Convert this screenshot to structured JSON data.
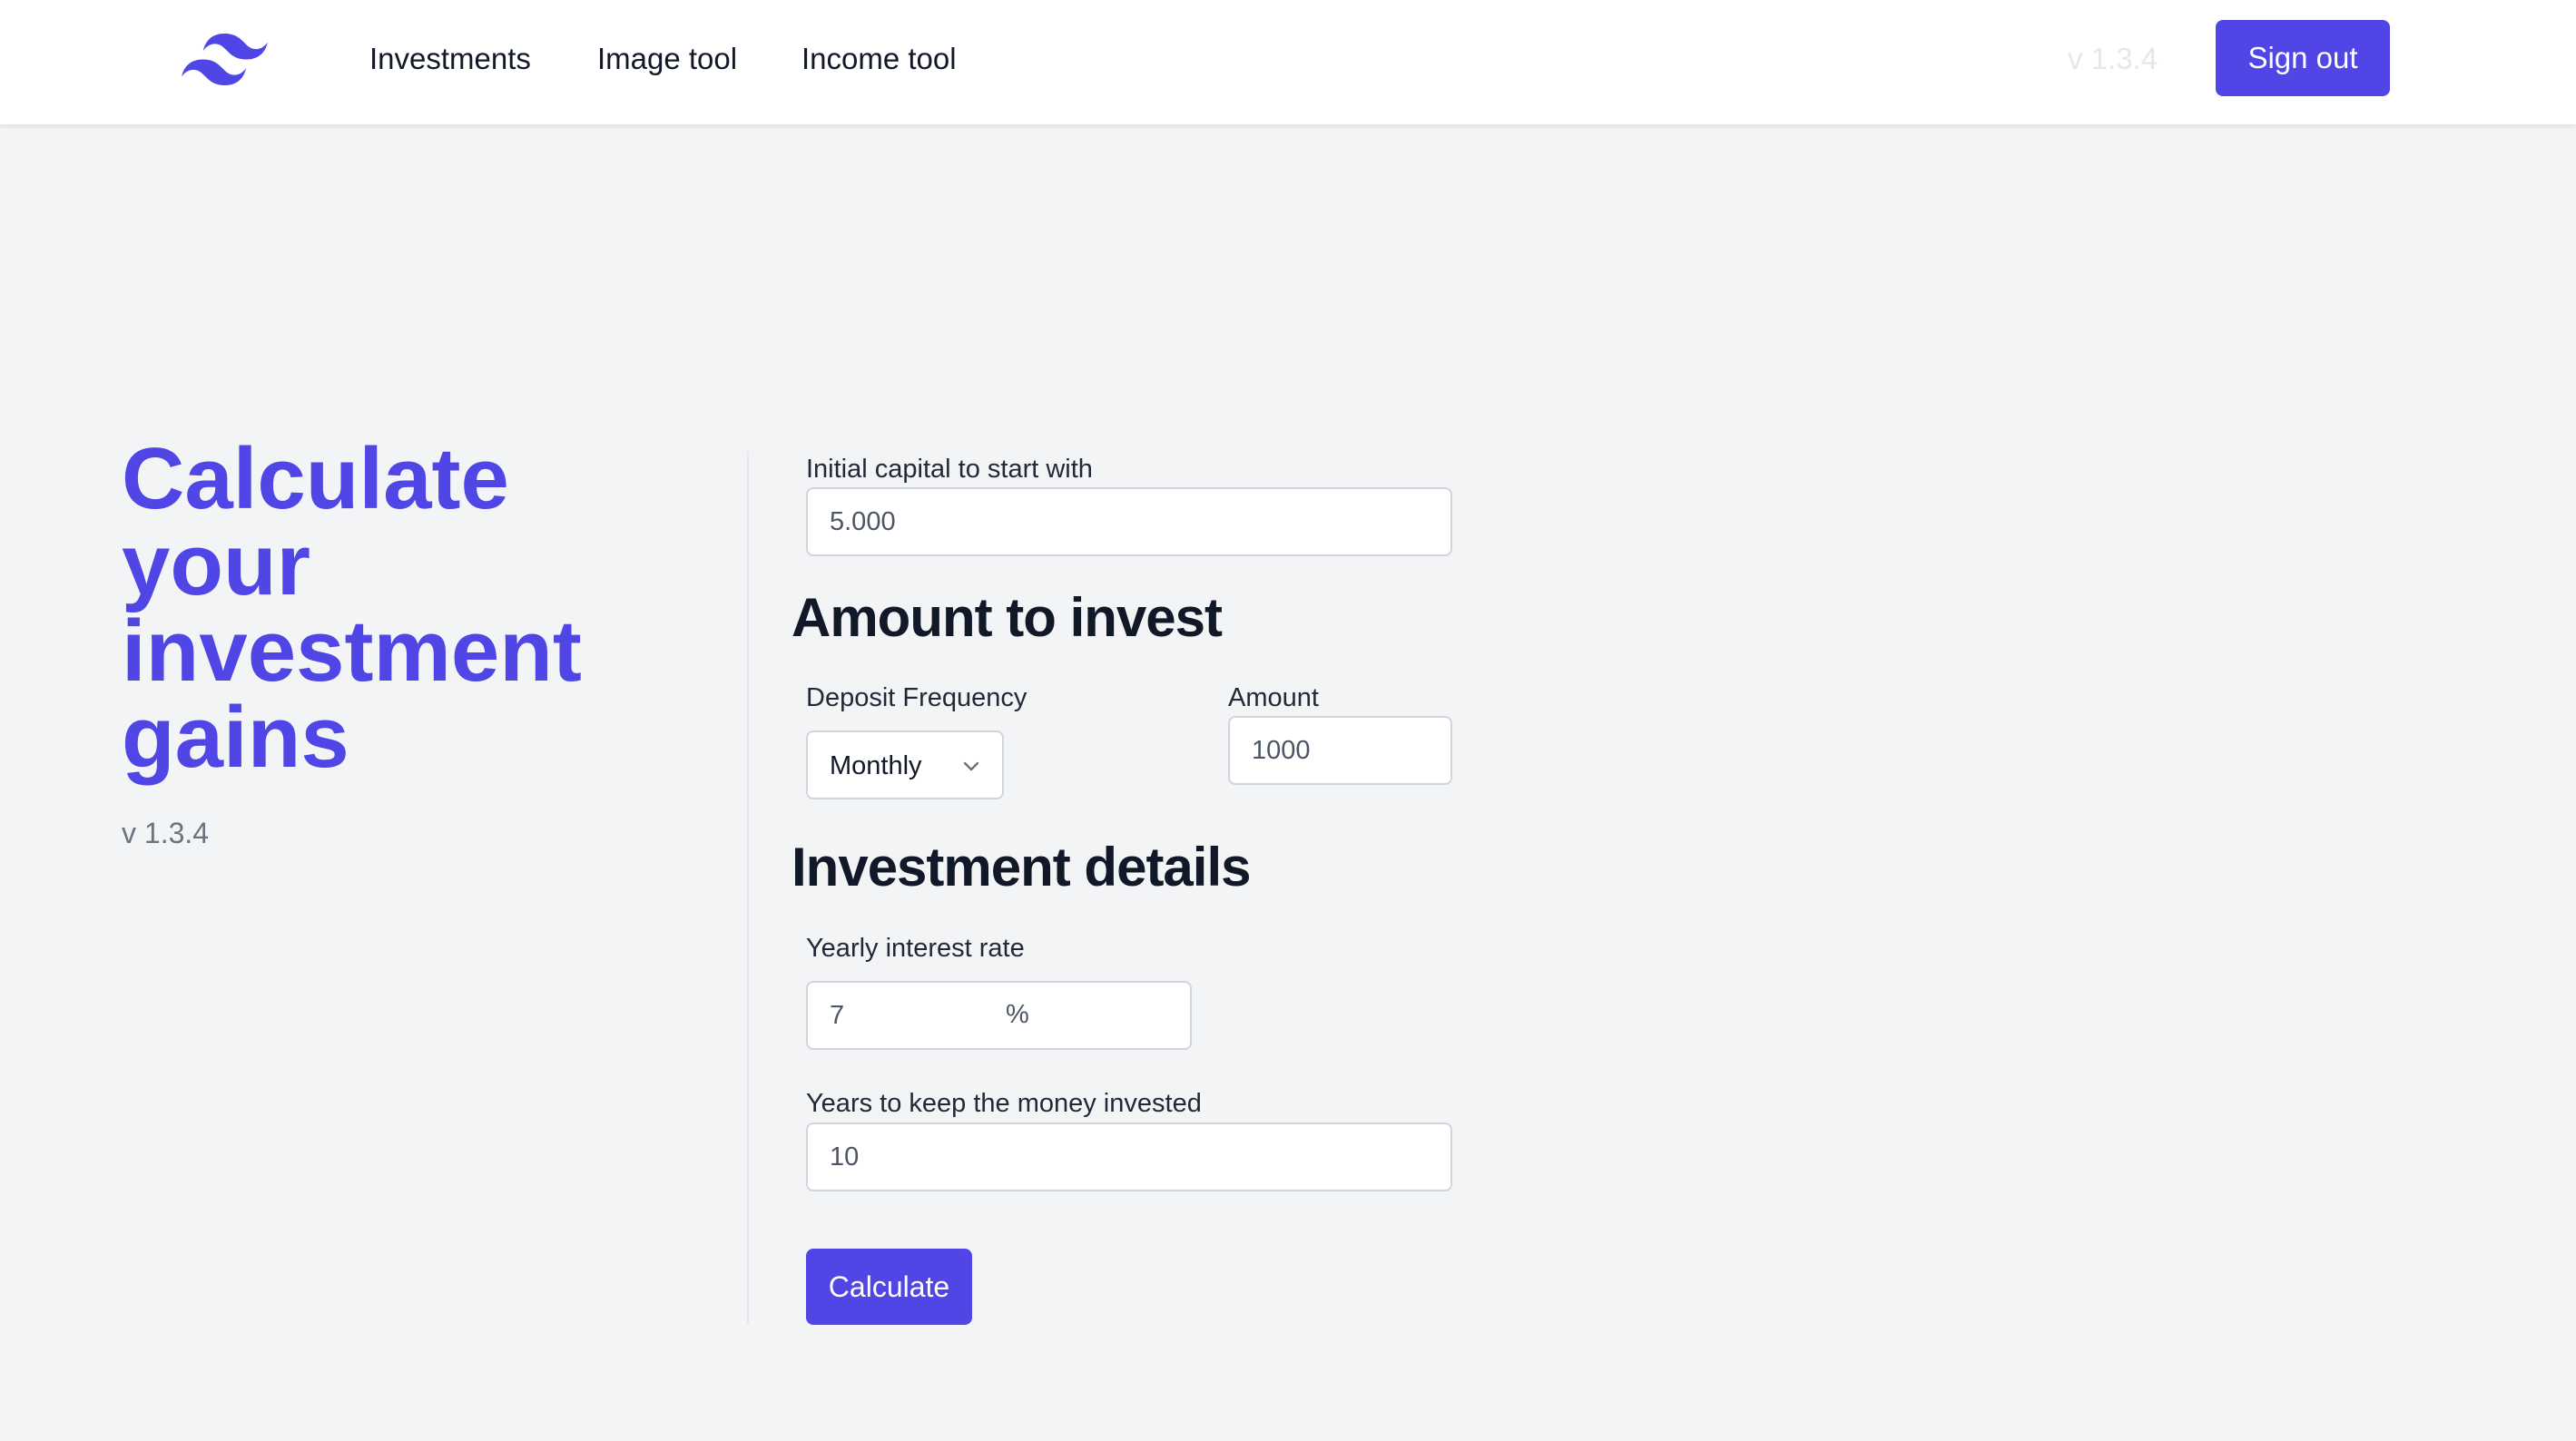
{
  "header": {
    "nav": [
      "Investments",
      "Image tool",
      "Income tool"
    ],
    "version": "v 1.3.4",
    "signout_label": "Sign out"
  },
  "hero": {
    "title_lines": [
      "Calculate",
      "your",
      "investment",
      "gains"
    ],
    "version": "v 1.3.4"
  },
  "form": {
    "initial_capital": {
      "label": "Initial capital to start with",
      "value": "5.000"
    },
    "amount_section_title": "Amount to invest",
    "deposit_frequency": {
      "label": "Deposit Frequency",
      "value": "Monthly"
    },
    "amount": {
      "label": "Amount",
      "value": "1000"
    },
    "details_section_title": "Investment details",
    "interest_rate": {
      "label": "Yearly interest rate",
      "value": "7",
      "unit": "%"
    },
    "years": {
      "label": "Years to keep the money invested",
      "value": "10"
    },
    "calculate_label": "Calculate"
  },
  "colors": {
    "accent": "#4f46e5",
    "background": "#f3f4f6",
    "version_header": "#e5e7eb"
  },
  "icons": {
    "logo": "wave-logo-icon",
    "chevron": "chevron-down-icon"
  }
}
